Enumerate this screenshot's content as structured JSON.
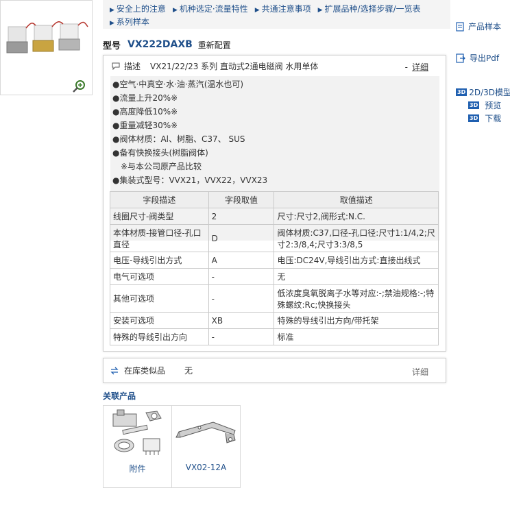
{
  "nav": {
    "row1": [
      "安全上的注意",
      "机种选定·流量特性",
      "共通注意事项",
      "扩展品种/选择步骤/一览表"
    ],
    "row2": [
      "系列样本"
    ]
  },
  "model": {
    "label": "型号",
    "code": "VX222DAXB",
    "reconfig": "重新配置"
  },
  "side": {
    "catalog": "产品样本",
    "pdf": "导出Pdf",
    "model3d": "2D/3D模型",
    "preview": "预览",
    "download": "下载",
    "badge": "3D"
  },
  "description": {
    "label": "描述",
    "title": "VX21/22/23 系列 直动式2通电磁阀 水用单体",
    "detail": "详细",
    "features": [
      "●空气·中真空·水·油·蒸汽(温水也可)",
      "●流量上升20%※",
      "●高度降低10%※",
      "●重量减轻30%※",
      "●阀体材质：Al、树脂、C37、 SUS",
      "●备有快换接头(树脂阀体)",
      "　※与本公司原产品比较",
      "●集装式型号：VVX21，VVX22，VVX23"
    ]
  },
  "spec_table": {
    "headers": [
      "字段描述",
      "字段取值",
      "取值描述"
    ],
    "rows": [
      [
        "线圈尺寸-阀类型",
        "2",
        "尺寸:尺寸2,阀形式:N.C."
      ],
      [
        "本体材质-接管口径-孔口直径",
        "D",
        "阀体材质:C37,口径-孔口径:尺寸1:1/4,2;尺寸2:3/8,4;尺寸3:3/8,5"
      ],
      [
        "电压-导线引出方式",
        "A",
        "电压:DC24V,导线引出方式:直接出线式"
      ],
      [
        "电气可选项",
        "-",
        "无"
      ],
      [
        "其他可选项",
        "-",
        "低浓度臭氧脱离子水等对应:-;禁油规格:-;特殊螺纹:Rc;快换接头"
      ],
      [
        "安装可选项",
        "XB",
        "特殊的导线引出方向/带托架"
      ],
      [
        "特殊的导线引出方向",
        "-",
        "标准"
      ]
    ]
  },
  "stock": {
    "label": "在库类似品",
    "value": "无",
    "detail": "详细"
  },
  "related": {
    "title": "关联产品",
    "items": [
      "附件",
      "VX02-12A"
    ]
  },
  "colors": {
    "link": "#1f4f8a",
    "badge": "#1f5fb0",
    "panel": "#f2f2f2",
    "border": "#cfcfcf"
  }
}
